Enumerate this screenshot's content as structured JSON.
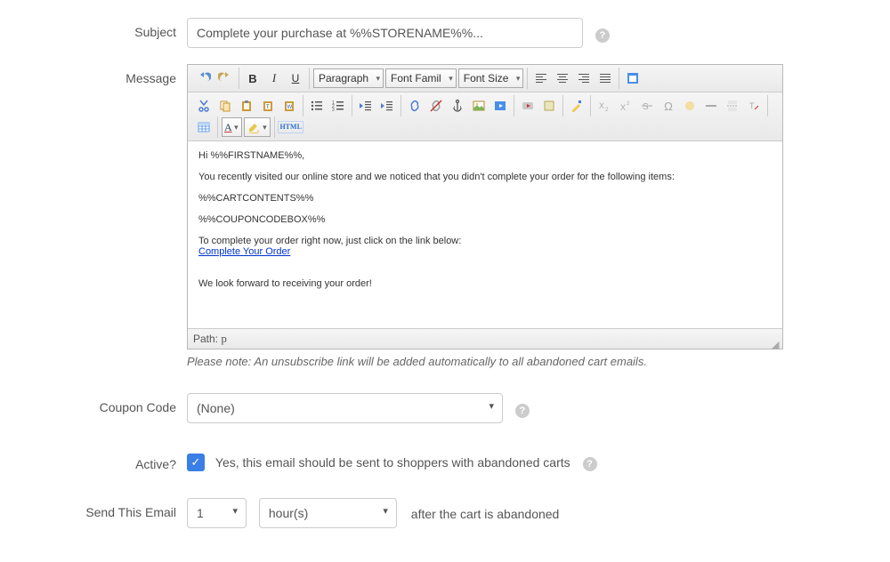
{
  "labels": {
    "subject": "Subject",
    "message": "Message",
    "coupon": "Coupon Code",
    "active": "Active?",
    "send": "Send This Email"
  },
  "subject": {
    "value": "Complete your purchase at %%STORENAME%%..."
  },
  "editor": {
    "dropdowns": {
      "format": "Paragraph",
      "font": "Font Famil",
      "size": "Font Size"
    },
    "path_label": "Path:",
    "path_value": "p",
    "body": {
      "greeting": "Hi %%FIRSTNAME%%,",
      "line1": "You recently visited our online store and we noticed that you didn't complete your order for the following items:",
      "cart": "%%CARTCONTENTS%%",
      "couponbox": "%%COUPONCODEBOX%%",
      "cta_intro": "To complete your order right now, just click on the link below:",
      "cta_link": "Complete Your Order",
      "closing": "We look forward to receiving your order!"
    }
  },
  "note": "Please note: An unsubscribe link will be added automatically to all abandoned cart emails.",
  "coupon": {
    "selected": "(None)"
  },
  "active": {
    "text": "Yes, this email should be sent to shoppers with abandoned carts",
    "checked": true
  },
  "send_email": {
    "qty": "1",
    "unit": "hour(s)",
    "suffix": "after the cart is abandoned"
  },
  "help_icon_glyph": "?"
}
